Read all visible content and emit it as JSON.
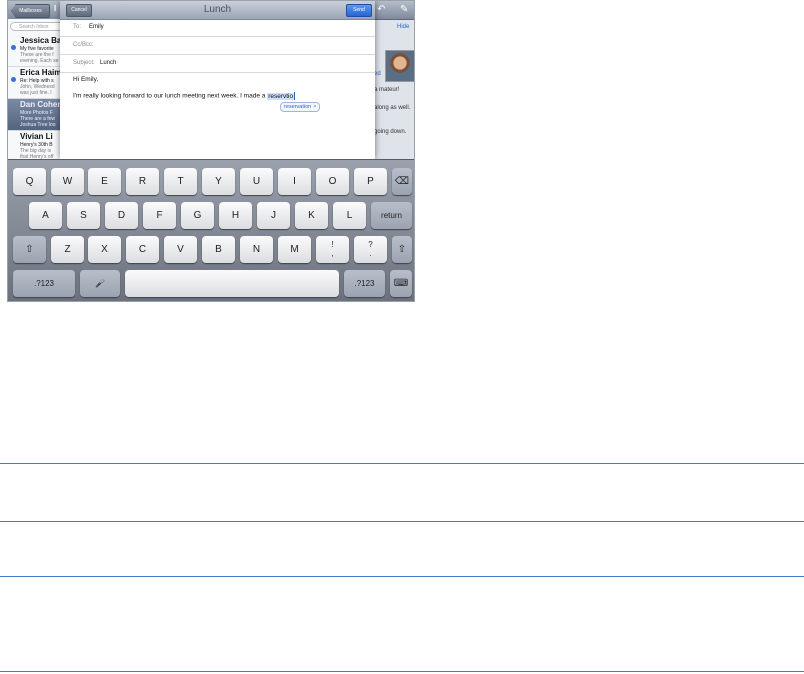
{
  "topbar": {
    "mailboxes_label": "Mailboxes",
    "inbox_fragment": "I"
  },
  "sidebar": {
    "search_placeholder": "Search Inbox",
    "messages": [
      {
        "name": "Jessica Ba",
        "subject": "My five favorite",
        "preview1": "These are the f",
        "preview2": "evening. Each se",
        "unread": true
      },
      {
        "name": "Erica Haim",
        "subject": "Re: Help with s",
        "preview1": "John, Wednesd",
        "preview2": "was just fine. I",
        "unread": true
      },
      {
        "name": "Dan Cohen",
        "subject": "More Photos F",
        "preview1": "There are a few",
        "preview2": "Joshua Tree loo",
        "unread": false
      },
      {
        "name": "Vivian Li",
        "subject": "Henry's 30th B",
        "preview1": "The big day is",
        "preview2": "that Henry's off",
        "unread": false
      }
    ]
  },
  "detail": {
    "hide_label": "Hide",
    "tails": [
      "ed",
      "a mateur!",
      "along as well.",
      "going down."
    ]
  },
  "compose": {
    "cancel_label": "Cancel",
    "title": "Lunch",
    "send_label": "Send",
    "to_label": "To:",
    "to_value": "Emily",
    "cc_label": "Cc/Bcc:",
    "subject_label": "Subject:",
    "subject_value": "Lunch",
    "greeting": "Hi Emily,",
    "body_text": "I'm really looking forward to our lunch meeting next week. I made a",
    "typed_word": "reservtio",
    "suggestion": "reservation",
    "suggestion_dismiss": "×"
  },
  "keyboard": {
    "row1": [
      "Q",
      "W",
      "E",
      "R",
      "T",
      "Y",
      "U",
      "I",
      "O",
      "P"
    ],
    "row2": [
      "A",
      "S",
      "D",
      "F",
      "G",
      "H",
      "J",
      "K",
      "L"
    ],
    "row3": [
      "Z",
      "X",
      "C",
      "V",
      "B",
      "N",
      "M"
    ],
    "excl_top": "!",
    "excl_bottom": ",",
    "quest_top": "?",
    "quest_bottom": ".",
    "return_label": "return",
    "numbers_label": ".?123",
    "backspace_icon": "⌫",
    "shift_icon": "⇧",
    "mic_icon": "🎤",
    "hide_keyboard_icon": "⌨"
  }
}
